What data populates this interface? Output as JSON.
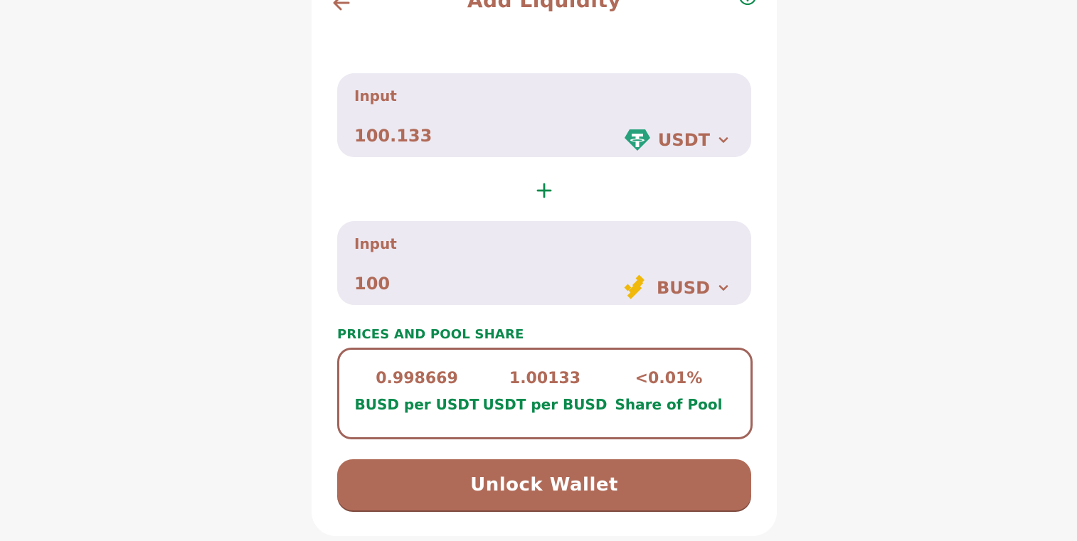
{
  "header": {
    "title": "Add Liquidity",
    "back_icon": "arrow-left-icon",
    "help_icon": "question-circle-icon"
  },
  "input_a": {
    "label": "Input",
    "value": "100.133",
    "token": "USDT",
    "token_icon": "tether-icon"
  },
  "input_b": {
    "label": "Input",
    "value": "100",
    "token": "BUSD",
    "token_icon": "binance-usd-icon"
  },
  "plus_icon": "plus-icon",
  "pool": {
    "section_title": "PRICES AND POOL SHARE",
    "items": [
      {
        "value": "0.998669",
        "label": "BUSD per USDT"
      },
      {
        "value": "1.00133",
        "label": "USDT per BUSD"
      },
      {
        "value": "<0.01%",
        "label": "Share of Pool"
      }
    ]
  },
  "action": {
    "label": "Unlock Wallet"
  },
  "colors": {
    "accent": "#b06a58",
    "green": "#0a8a4c",
    "input_bg": "#ece9f2",
    "page_bg": "#f7f7f7"
  }
}
